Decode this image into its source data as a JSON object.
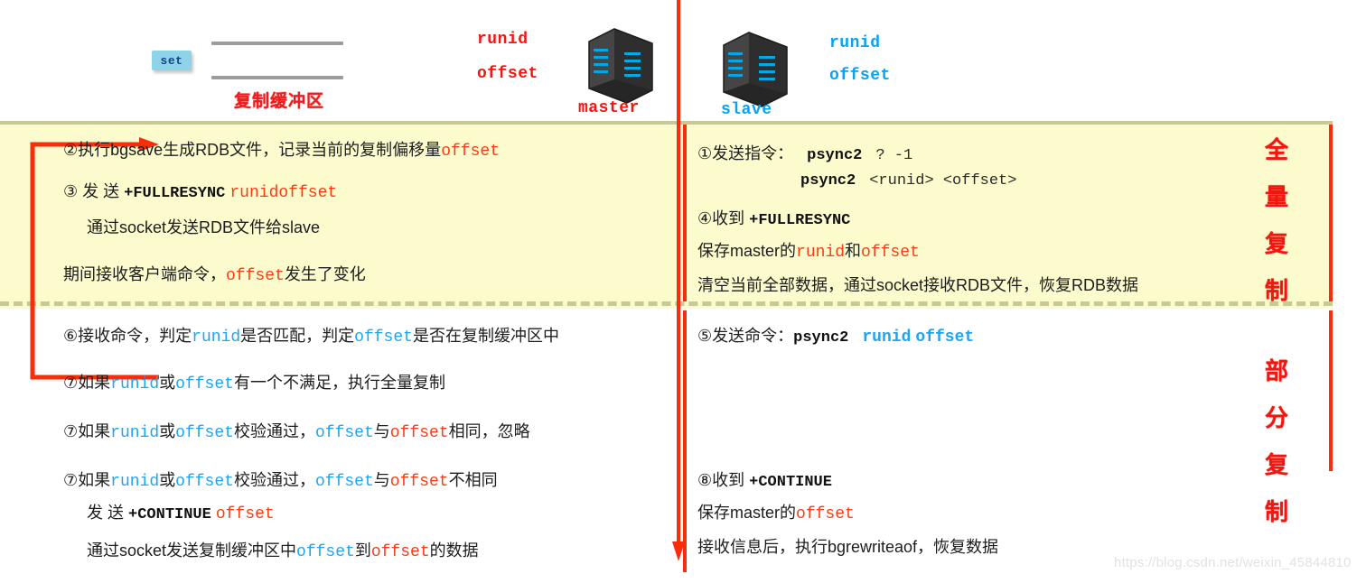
{
  "header": {
    "set_chip": "set",
    "buffer_label": "复制缓冲区",
    "master": {
      "runid": "runid",
      "offset": "offset",
      "name": "master"
    },
    "slave": {
      "runid": "runid",
      "offset": "offset",
      "name": "slave"
    }
  },
  "sections": {
    "full": {
      "vertical_label": [
        "全",
        "量",
        "复",
        "制"
      ]
    },
    "partial": {
      "vertical_label": [
        "部",
        "分",
        "复",
        "制"
      ]
    }
  },
  "master_column": {
    "step2": {
      "prefix": "②执行bgsave生成RDB文件，记录当前的复制偏移量",
      "offset": "offset"
    },
    "step3": {
      "prefix": "③ 发 送 ",
      "cmd": "+FULLRESYNC",
      "runid": "runid",
      "offset": "offset",
      "sub": "通过socket发送RDB文件给slave"
    },
    "note": {
      "prefix": "期间接收客户端命令，",
      "offset": "offset",
      "suffix": "发生了变化"
    },
    "step6": {
      "a": "⑥接收命令，判定",
      "runid": "runid",
      "b": "是否匹配，判定",
      "offset": "offset",
      "c": "是否在复制缓冲区中"
    },
    "step7a": {
      "a": "⑦如果",
      "runid": "runid",
      "b": "或",
      "offset": "offset",
      "c": "有一个不满足，执行全量复制"
    },
    "step7b": {
      "a": "⑦如果",
      "runid": "runid",
      "b": "或",
      "offset": "offset",
      "c": "校验通过，",
      "offset_blue": "offset",
      "d": "与",
      "offset_red": "offset",
      "e": "相同，忽略"
    },
    "step7c": {
      "a": "⑦如果",
      "runid": "runid",
      "b": "或",
      "offset": "offset",
      "c": "校验通过，",
      "offset_blue": "offset",
      "d": "与",
      "offset_red": "offset",
      "e": "不相同",
      "sub1_prefix": "发 送 ",
      "sub1_cmd": "+CONTINUE",
      "sub1_offset": "offset",
      "sub2_a": "通过socket发送复制缓冲区中",
      "sub2_offset_blue": "offset",
      "sub2_b": "到",
      "sub2_offset_red": "offset",
      "sub2_c": "的数据"
    }
  },
  "slave_column": {
    "step1": {
      "prefix": "①发送指令：",
      "cmd1": "psync2",
      "args1": "? -1",
      "cmd2": "psync2",
      "args2": "<runid> <offset>"
    },
    "step4": {
      "prefix": "④收到 ",
      "cmd": "+FULLRESYNC",
      "line2_a": "保存master的",
      "line2_runid": "runid",
      "line2_b": "和",
      "line2_offset": "offset",
      "line3": "清空当前全部数据，通过socket接收RDB文件，恢复RDB数据"
    },
    "step5": {
      "prefix": "⑤发送命令：",
      "cmd": "psync2",
      "runid": "runid",
      "offset": "offset"
    },
    "step8": {
      "prefix": "⑧收到 ",
      "cmd": "+CONTINUE",
      "line2_a": "保存master的",
      "line2_offset": "offset",
      "line3": "接收信息后，执行bgrewriteaof，恢复数据"
    }
  },
  "watermark": "https://blog.csdn.net/weixin_45844810",
  "colors": {
    "master_accent": "#f2160f",
    "slave_accent": "#07a2f0",
    "band_background": "#fbfbcd",
    "band_border": "#c9c899",
    "arrow": "#fa2d0a"
  }
}
